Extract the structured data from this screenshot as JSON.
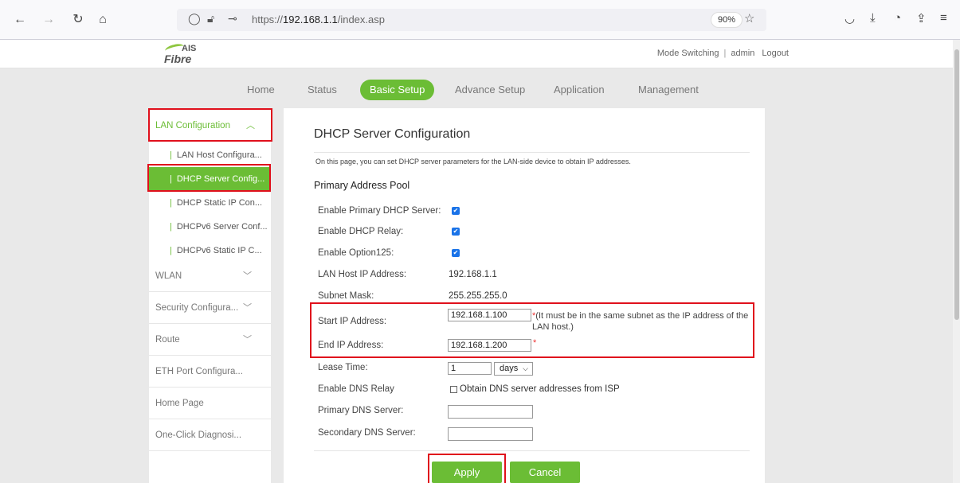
{
  "browser": {
    "url_prefix": "https://",
    "url_host": "192.168.1.1",
    "url_path": "/index.asp",
    "zoom": "90%"
  },
  "header": {
    "logo_top": "AIS",
    "logo_bottom": "Fibre",
    "mode_switching": "Mode Switching",
    "user": "admin",
    "logout": "Logout"
  },
  "nav": {
    "items": [
      "Home",
      "Status",
      "Basic Setup",
      "Advance Setup",
      "Application",
      "Management"
    ],
    "active": "Basic Setup"
  },
  "sidebar": {
    "lan_config": "LAN Configuration",
    "sub": [
      "LAN Host Configura...",
      "DHCP Server Config...",
      "DHCP Static IP Con...",
      "DHCPv6 Server Conf...",
      "DHCPv6 Static IP C..."
    ],
    "groups": [
      "WLAN",
      "Security Configura...",
      "Route",
      "ETH Port Configura...",
      "Home Page",
      "One-Click Diagnosi..."
    ]
  },
  "content": {
    "title": "DHCP Server Configuration",
    "description": "On this page, you can set DHCP server parameters for the LAN-side device to obtain IP addresses.",
    "section": "Primary Address Pool",
    "labels": {
      "enable_primary": "Enable Primary DHCP Server:",
      "enable_relay": "Enable DHCP Relay:",
      "enable_opt125": "Enable Option125:",
      "lan_host_ip": "LAN Host IP Address:",
      "subnet_mask": "Subnet Mask:",
      "start_ip": "Start IP Address:",
      "end_ip": "End IP Address:",
      "lease_time": "Lease Time:",
      "dns_relay": "Enable DNS Relay",
      "primary_dns": "Primary DNS Server:",
      "secondary_dns": "Secondary DNS Server:"
    },
    "values": {
      "lan_host_ip": "192.168.1.1",
      "subnet_mask": "255.255.255.0",
      "start_ip": "192.168.1.100",
      "end_ip": "192.168.1.200",
      "lease_time": "1",
      "lease_unit": "days",
      "primary_dns": "",
      "secondary_dns": ""
    },
    "start_ip_note": "(It must be in the same subnet as the IP address of the LAN host.)",
    "required_mark": "*",
    "dns_from_isp": "Obtain DNS server addresses from ISP",
    "apply": "Apply",
    "cancel": "Cancel"
  },
  "colors": {
    "accent_green": "#6bbd35",
    "highlight_red": "#e0101c",
    "checkbox_blue": "#1a73e8"
  }
}
